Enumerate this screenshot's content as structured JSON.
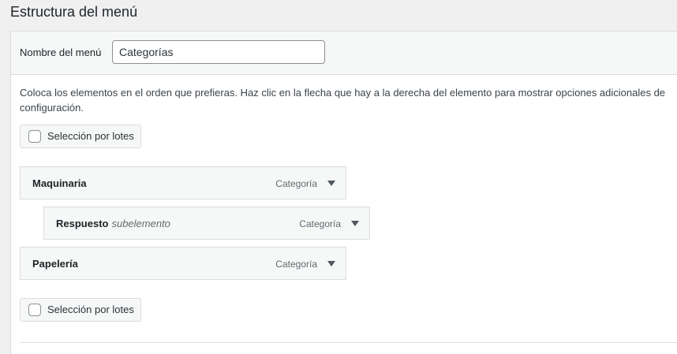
{
  "page": {
    "title": "Estructura del menú"
  },
  "menu_name": {
    "label": "Nombre del menú",
    "value": "Categorías"
  },
  "instructions": "Coloca los elementos en el orden que prefieras. Haz clic en la flecha que hay a la derecha del elemento para mostrar opciones adicionales de configuración.",
  "bulk_select": {
    "label": "Selección por lotes"
  },
  "items": [
    {
      "title": "Maquinaria",
      "sub": "",
      "type": "Categoría"
    },
    {
      "title": "Respuesto",
      "sub": "subelemento",
      "type": "Categoría"
    },
    {
      "title": "Papelería",
      "sub": "",
      "type": "Categoría"
    }
  ],
  "icons": {
    "toggle": "caret-down-icon"
  },
  "colors": {
    "background": "#f0f0f1",
    "panel": "#ffffff",
    "border": "#dcdcde",
    "text": "#1d2327",
    "muted": "#646970"
  }
}
